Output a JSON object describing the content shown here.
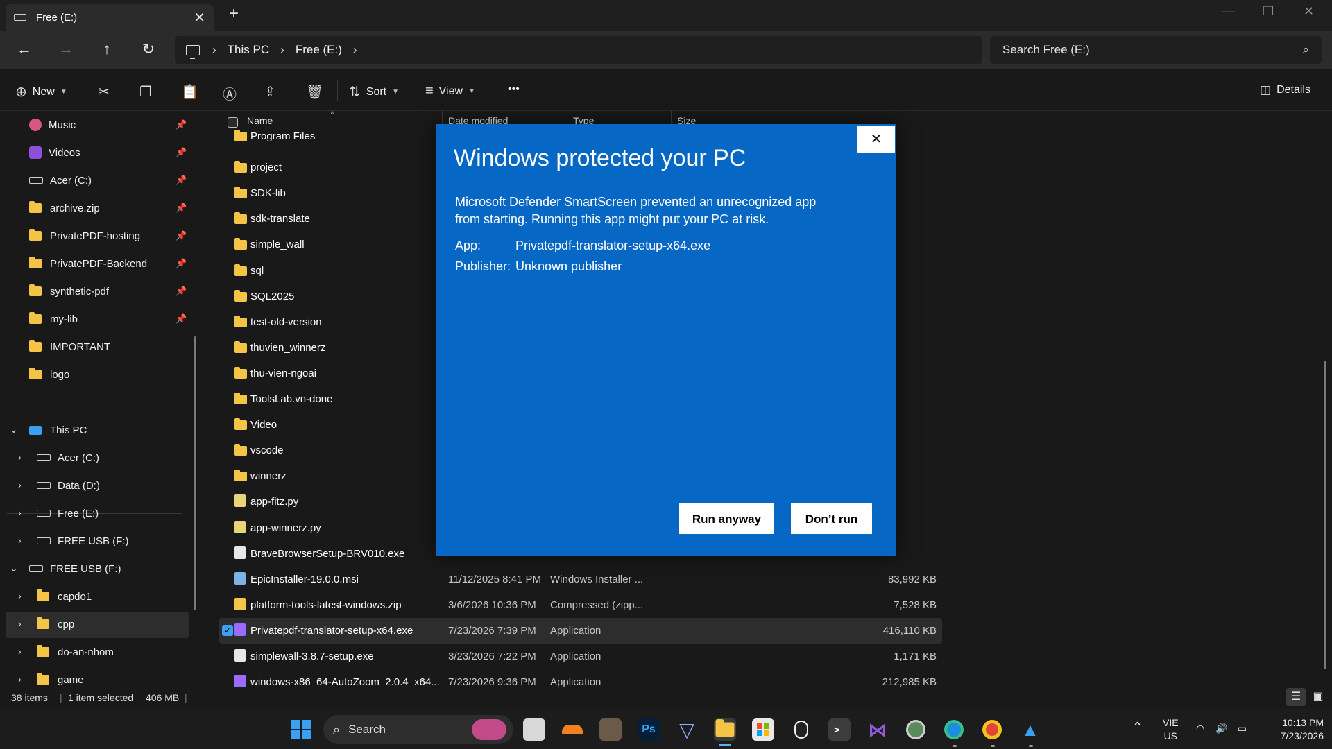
{
  "window": {
    "tab_title": "Free (E:)",
    "new_tab": "+",
    "close_tab": "✕"
  },
  "nav": {
    "breadcrumb": [
      "This PC",
      "Free (E:)"
    ],
    "search_placeholder": "Search Free (E:)"
  },
  "toolbar": {
    "new_label": "New",
    "sort_label": "Sort",
    "view_label": "View",
    "more_label": "•••",
    "details_label": "Details"
  },
  "sidebar": {
    "quick_access": [
      {
        "label": "Music",
        "icon": "music-icon",
        "pinned": true
      },
      {
        "label": "Videos",
        "icon": "videos-icon",
        "pinned": true
      },
      {
        "label": "Acer (C:)",
        "icon": "drive-icon",
        "pinned": true
      },
      {
        "label": "archive.zip",
        "icon": "folder-icon",
        "pinned": true
      },
      {
        "label": "PrivatePDF-hosting",
        "icon": "folder-icon",
        "pinned": true
      },
      {
        "label": "PrivatePDF-Backend",
        "icon": "folder-icon",
        "pinned": true
      },
      {
        "label": "synthetic-pdf",
        "icon": "folder-icon",
        "pinned": true
      },
      {
        "label": "my-lib",
        "icon": "folder-icon",
        "pinned": true
      },
      {
        "label": "IMPORTANT",
        "icon": "folder-icon",
        "pinned": false
      },
      {
        "label": "logo",
        "icon": "folder-icon",
        "pinned": false
      }
    ],
    "tree": [
      {
        "label": "This PC",
        "level": 0,
        "expanded": true,
        "icon": "pc-icon"
      },
      {
        "label": "Acer (C:)",
        "level": 1,
        "expanded": false,
        "icon": "drive-icon"
      },
      {
        "label": "Data (D:)",
        "level": 1,
        "expanded": false,
        "icon": "drive-icon"
      },
      {
        "label": "Free (E:)",
        "level": 1,
        "expanded": false,
        "icon": "drive-icon",
        "selected": true
      },
      {
        "label": "FREE USB (F:)",
        "level": 1,
        "expanded": false,
        "icon": "drive-icon"
      },
      {
        "label": "FREE USB (F:)",
        "level": 0,
        "expanded": true,
        "icon": "drive-icon"
      },
      {
        "label": "capdo1",
        "level": 1,
        "expanded": false,
        "icon": "folder-icon"
      },
      {
        "label": "cpp",
        "level": 1,
        "expanded": false,
        "icon": "folder-icon"
      },
      {
        "label": "do-an-nhom",
        "level": 1,
        "expanded": false,
        "icon": "folder-icon"
      },
      {
        "label": "game",
        "level": 1,
        "expanded": false,
        "icon": "folder-icon"
      }
    ]
  },
  "files": {
    "columns": {
      "name": "Name",
      "date": "Date modified",
      "type": "Type",
      "size": "Size"
    },
    "rows": [
      {
        "name": "Program Files",
        "icon": "folder-icon",
        "date": "",
        "type": "",
        "size": ""
      },
      {
        "name": "project",
        "icon": "folder-icon",
        "date": "",
        "type": "",
        "size": ""
      },
      {
        "name": "SDK-lib",
        "icon": "folder-icon",
        "date": "",
        "type": "",
        "size": ""
      },
      {
        "name": "sdk-translate",
        "icon": "folder-icon",
        "date": "",
        "type": "",
        "size": ""
      },
      {
        "name": "simple_wall",
        "icon": "folder-icon",
        "date": "",
        "type": "",
        "size": ""
      },
      {
        "name": "sql",
        "icon": "folder-icon",
        "date": "",
        "type": "",
        "size": ""
      },
      {
        "name": "SQL2025",
        "icon": "folder-icon",
        "date": "",
        "type": "",
        "size": ""
      },
      {
        "name": "test-old-version",
        "icon": "folder-icon",
        "date": "",
        "type": "",
        "size": ""
      },
      {
        "name": "thuvien_winnerz",
        "icon": "folder-icon",
        "date": "",
        "type": "",
        "size": ""
      },
      {
        "name": "thu-vien-ngoai",
        "icon": "folder-icon",
        "date": "",
        "type": "",
        "size": ""
      },
      {
        "name": "ToolsLab.vn-done",
        "icon": "folder-icon",
        "date": "",
        "type": "",
        "size": ""
      },
      {
        "name": "Video",
        "icon": "folder-icon",
        "date": "",
        "type": "",
        "size": ""
      },
      {
        "name": "vscode",
        "icon": "folder-icon",
        "date": "",
        "type": "",
        "size": ""
      },
      {
        "name": "winnerz",
        "icon": "folder-icon",
        "date": "",
        "type": "",
        "size": ""
      },
      {
        "name": "app-fitz.py",
        "icon": "python-file-icon",
        "date": "",
        "type": "",
        "size": ""
      },
      {
        "name": "app-winnerz.py",
        "icon": "python-file-icon",
        "date": "",
        "type": "",
        "size": ""
      },
      {
        "name": "BraveBrowserSetup-BRV010.exe",
        "icon": "installer-icon",
        "date": "",
        "type": "",
        "size": ""
      },
      {
        "name": "EpicInstaller-19.0.0.msi",
        "icon": "msi-icon",
        "date": "11/12/2025 8:41 PM",
        "type": "Windows Installer ...",
        "size": "83,992 KB"
      },
      {
        "name": "platform-tools-latest-windows.zip",
        "icon": "zip-icon",
        "date": "3/6/2026 10:36 PM",
        "type": "Compressed (zipp...",
        "size": "7,528 KB"
      },
      {
        "name": "Privatepdf-translator-setup-x64.exe",
        "icon": "app-icon",
        "date": "7/23/2026 7:39 PM",
        "type": "Application",
        "size": "416,110 KB",
        "selected": true
      },
      {
        "name": "simplewall-3.8.7-setup.exe",
        "icon": "installer-icon",
        "date": "3/23/2026 7:22 PM",
        "type": "Application",
        "size": "1,171 KB"
      },
      {
        "name": "windows-x86_64-AutoZoom_2.0.4_x64...",
        "icon": "app-icon",
        "date": "7/23/2026 9:36 PM",
        "type": "Application",
        "size": "212,985 KB"
      }
    ]
  },
  "status": {
    "item_count": "38 items",
    "selection": "1 item selected",
    "selection_size": "406 MB"
  },
  "dialog": {
    "title": "Windows protected your PC",
    "message": "Microsoft Defender SmartScreen prevented an unrecognized app from starting. Running this app might put your PC at risk.",
    "app_label": "App:",
    "app_value": "Privatepdf-translator-setup-x64.exe",
    "publisher_label": "Publisher:",
    "publisher_value": "Unknown publisher",
    "run_anyway": "Run anyway",
    "dont_run": "Don’t run",
    "close": "✕",
    "bg_color": "#0667c4"
  },
  "taskbar": {
    "search_label": "Search",
    "apps": [
      "start-icon",
      "task-view-icon",
      "cloudflare-icon",
      "game-icon",
      "photoshop-icon",
      "vpn-icon",
      "file-explorer-icon",
      "store-icon",
      "qq-icon",
      "terminal-icon",
      "visual-studio-icon",
      "chrome-app-icon",
      "edge-icon",
      "chrome-icon",
      "app-icon"
    ],
    "ps_label": "Ps",
    "lang_top": "VIE",
    "lang_bottom": "US",
    "time": "10:13 PM",
    "date": "7/23/2026"
  }
}
